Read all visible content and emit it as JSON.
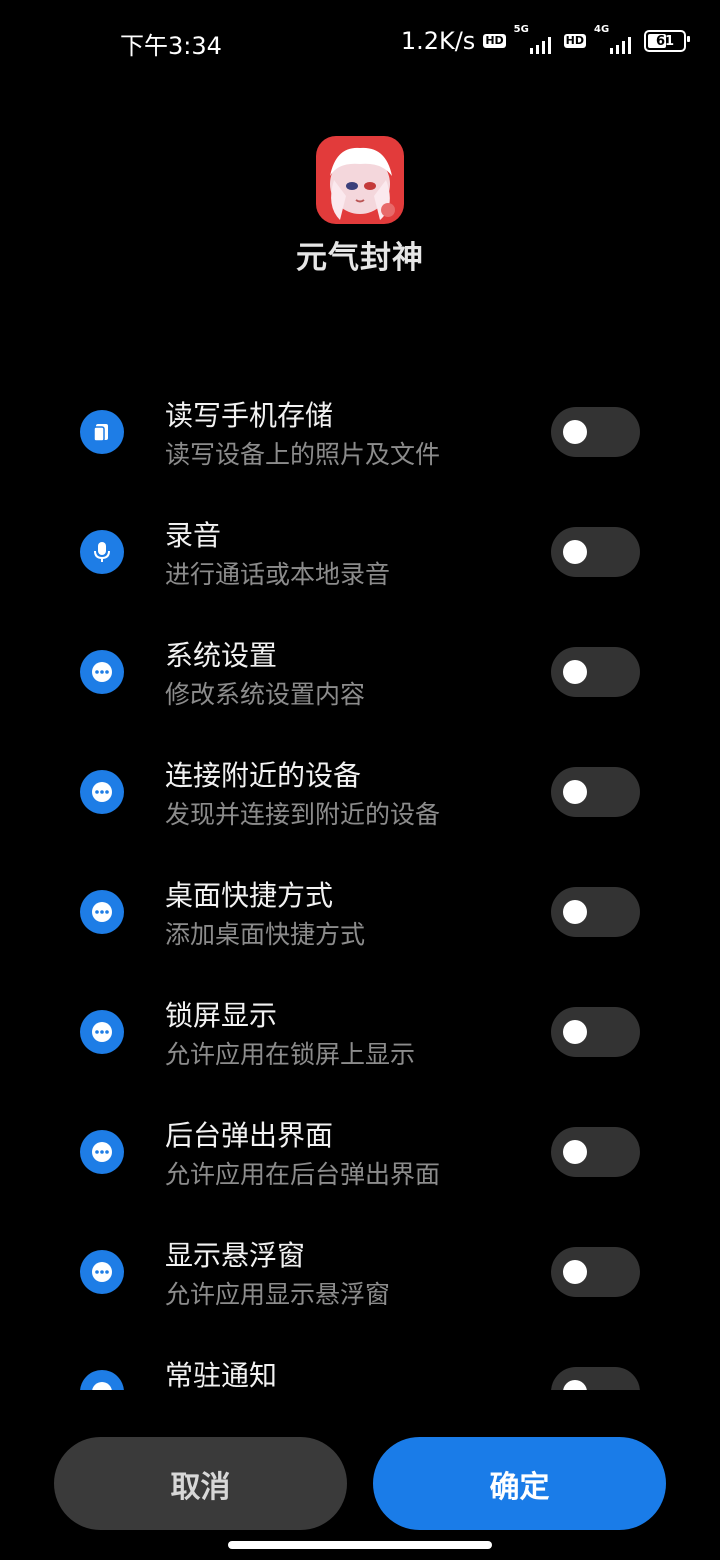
{
  "status_bar": {
    "time": "下午3:34",
    "net_speed": "1.2K/s",
    "sim1": {
      "hd": "HD",
      "gen": "5G"
    },
    "sim2": {
      "hd": "HD",
      "gen": "4G"
    },
    "battery": "61",
    "battery_level": 0.61
  },
  "app": {
    "name": "元气封神",
    "icon": "app-icon"
  },
  "permissions": [
    {
      "title": "读写手机存储",
      "desc": "读写设备上的照片及文件",
      "icon": "storage-icon",
      "enabled": false
    },
    {
      "title": "录音",
      "desc": "进行通话或本地录音",
      "icon": "microphone-icon",
      "enabled": false
    },
    {
      "title": "系统设置",
      "desc": "修改系统设置内容",
      "icon": "more-dots-icon",
      "enabled": false
    },
    {
      "title": "连接附近的设备",
      "desc": "发现并连接到附近的设备",
      "icon": "more-dots-icon",
      "enabled": false
    },
    {
      "title": "桌面快捷方式",
      "desc": "添加桌面快捷方式",
      "icon": "more-dots-icon",
      "enabled": false
    },
    {
      "title": "锁屏显示",
      "desc": "允许应用在锁屏上显示",
      "icon": "more-dots-icon",
      "enabled": false
    },
    {
      "title": "后台弹出界面",
      "desc": "允许应用在后台弹出界面",
      "icon": "more-dots-icon",
      "enabled": false
    },
    {
      "title": "显示悬浮窗",
      "desc": "允许应用显示悬浮窗",
      "icon": "more-dots-icon",
      "enabled": false
    },
    {
      "title": "常驻通知",
      "desc": "",
      "icon": "more-dots-icon",
      "enabled": false
    }
  ],
  "buttons": {
    "cancel": "取消",
    "confirm": "确定"
  },
  "colors": {
    "accent": "#1a7ce8",
    "background": "#000000",
    "toggle_off": "#333333"
  }
}
